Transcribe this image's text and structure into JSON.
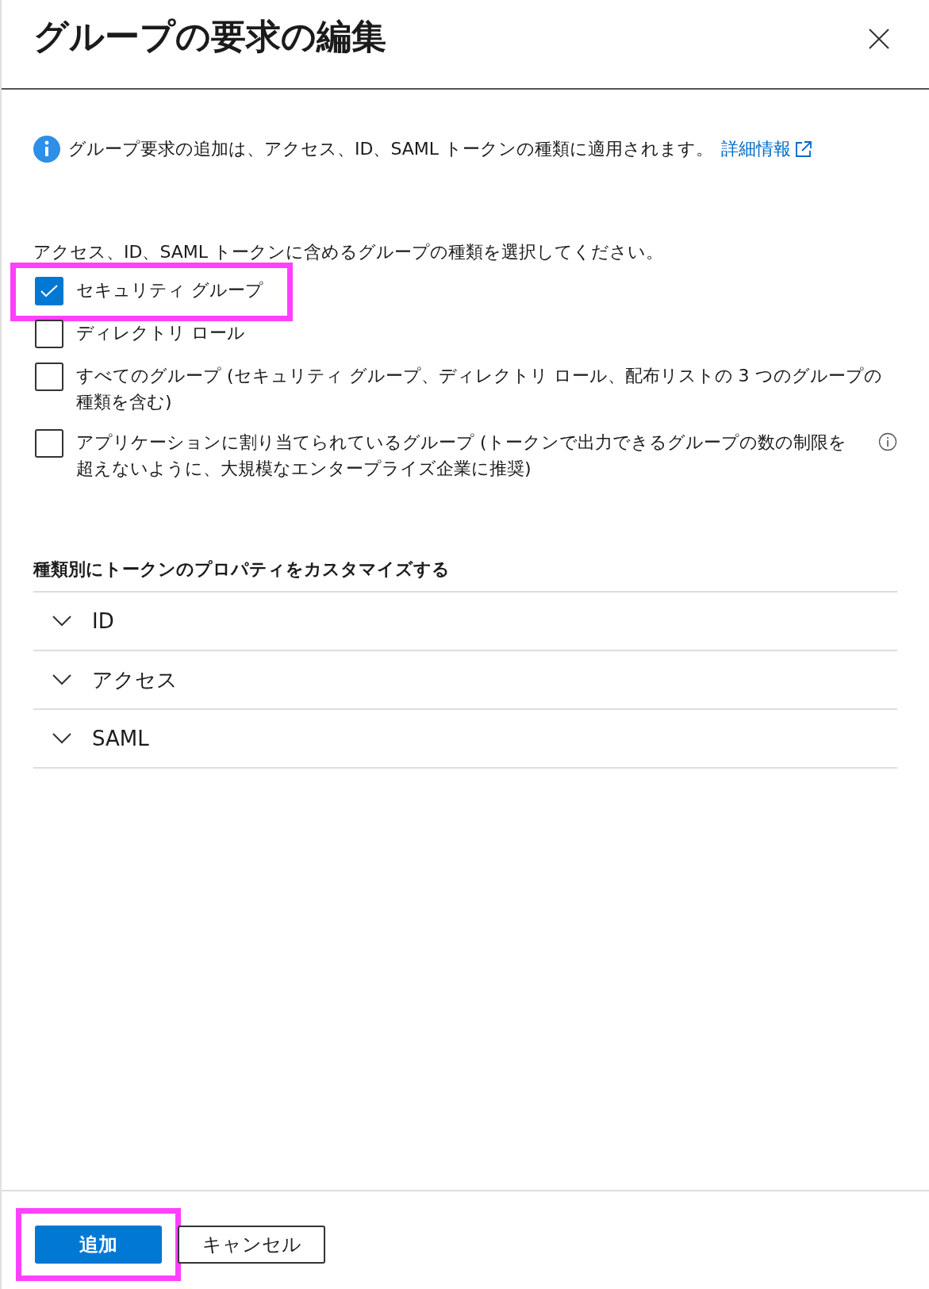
{
  "panel": {
    "title": "グループの要求の編集"
  },
  "info_banner": {
    "text": "グループ要求の追加は、アクセス、ID、SAML トークンの種類に適用されます。",
    "link": "詳細情報"
  },
  "group_types": {
    "prompt": "アクセス、ID、SAML トークンに含めるグループの種類を選択してください。",
    "options": [
      {
        "label": "セキュリティ グループ",
        "checked": true,
        "highlighted": true,
        "info_icon": false
      },
      {
        "label": "ディレクトリ ロール",
        "checked": false,
        "highlighted": false,
        "info_icon": false
      },
      {
        "label": "すべてのグループ (セキュリティ グループ、ディレクトリ ロール、配布リストの 3 つのグループの種類を含む)",
        "checked": false,
        "highlighted": false,
        "info_icon": false
      },
      {
        "label": "アプリケーションに割り当てられているグループ (トークンで出力できるグループの数の制限を超えないように、大規模なエンタープライズ企業に推奨)",
        "checked": false,
        "highlighted": false,
        "info_icon": true
      }
    ]
  },
  "customize": {
    "heading": "種類別にトークンのプロパティをカスタマイズする",
    "sections": [
      {
        "label": "ID",
        "expanded": false
      },
      {
        "label": "アクセス",
        "expanded": false
      },
      {
        "label": "SAML",
        "expanded": false
      }
    ]
  },
  "buttons": [
    {
      "label": "追加",
      "kind": "primary",
      "highlighted": true
    },
    {
      "label": "キャンセル",
      "kind": "secondary",
      "highlighted": false
    }
  ]
}
